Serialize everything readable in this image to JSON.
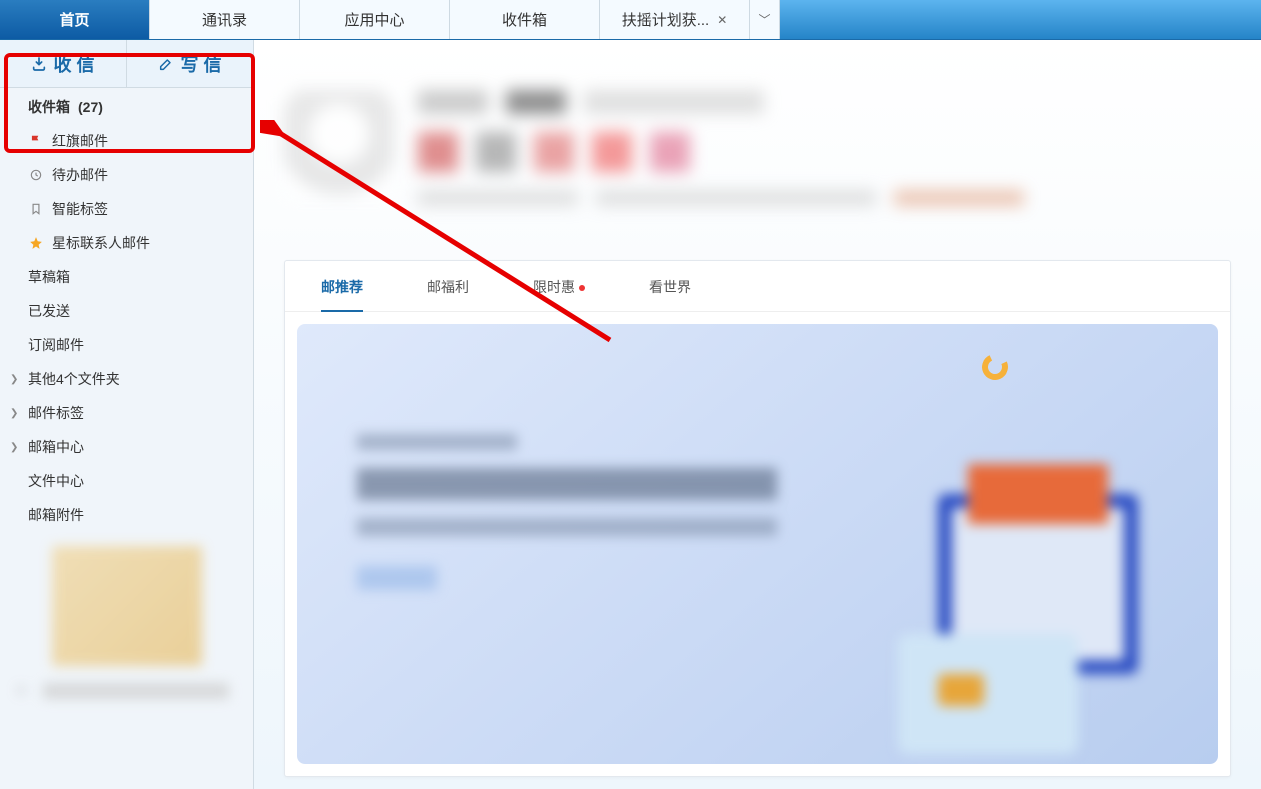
{
  "topTabs": [
    {
      "label": "首页",
      "active": true
    },
    {
      "label": "通讯录"
    },
    {
      "label": "应用中心"
    },
    {
      "label": "收件箱"
    },
    {
      "label": "扶摇计划获...",
      "closeable": true
    }
  ],
  "compose": {
    "receive": "收 信",
    "write": "写 信"
  },
  "folders": {
    "inbox": "收件箱",
    "inboxCount": "(27)",
    "flagged": "红旗邮件",
    "todo": "待办邮件",
    "smartTags": "智能标签",
    "starContacts": "星标联系人邮件",
    "drafts": "草稿箱",
    "sent": "已发送",
    "subs": "订阅邮件",
    "otherFolders": "其他4个文件夹",
    "mailTags": "邮件标签",
    "mailCenter": "邮箱中心",
    "fileCenter": "文件中心",
    "attachments": "邮箱附件"
  },
  "contentTabs": {
    "rec": "邮推荐",
    "welfare": "邮福利",
    "limited": "限时惠",
    "world": "看世界"
  }
}
